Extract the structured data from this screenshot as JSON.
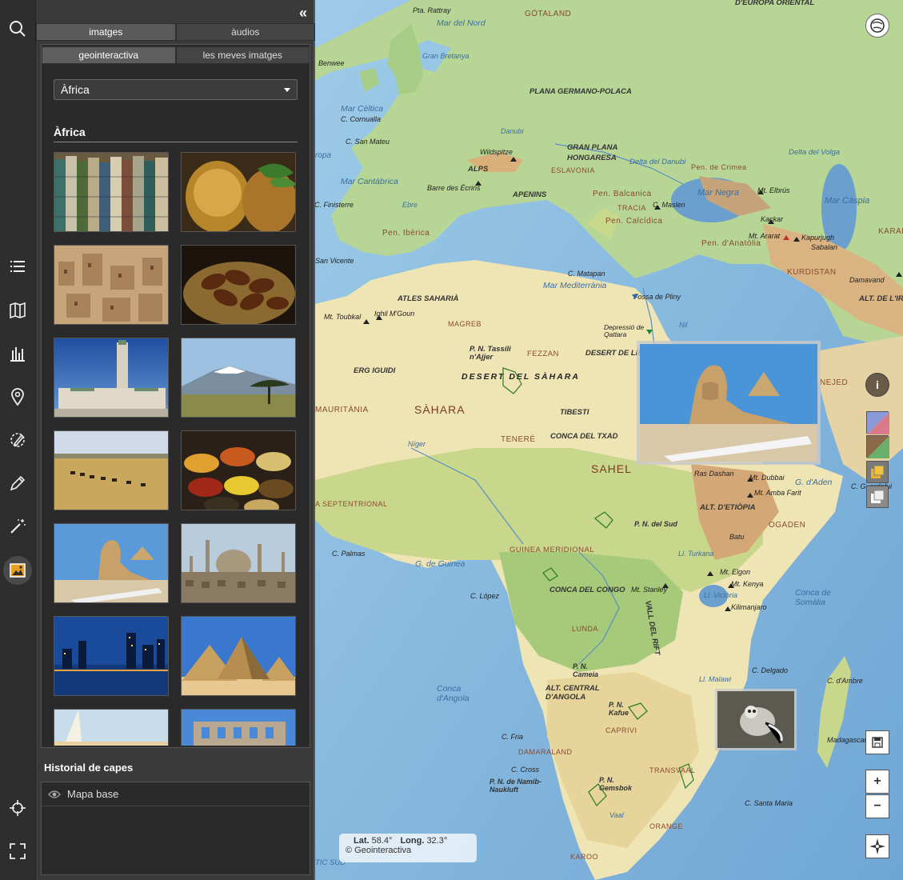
{
  "rail": {
    "items": [
      "search-icon",
      "list-icon",
      "map-book-icon",
      "chart-icon",
      "pin-icon",
      "draw-icon",
      "pencil-icon",
      "wand-icon",
      "image-icon"
    ],
    "bottom": [
      "crosshair-icon",
      "fullscreen-icon"
    ]
  },
  "panel": {
    "collapse": "«",
    "tabs": [
      "imatges",
      "àudios"
    ],
    "subtabs": [
      "geointeractiva",
      "les meves imatges"
    ],
    "select_value": "Àfrica",
    "section_title": "Àfrica",
    "thumbnails": [
      "carpets",
      "mint-tea",
      "kasbah",
      "dates",
      "hassan-mosque",
      "kilimanjaro",
      "savanna",
      "spices",
      "sphinx",
      "cairo-mosque",
      "city-night",
      "pyramids",
      "sail",
      "ruins"
    ]
  },
  "historial": {
    "title": "Historial de capes",
    "layer": "Mapa base"
  },
  "map": {
    "labels": {
      "pta_rattray": "Pta. Rattray",
      "mar_del_nord": "Mar del Nord",
      "gotaland": "GÖTALAND",
      "europa_oriental": "D'EUROPA ORIENTAL",
      "gran_bretanya": "Gran Bretanya",
      "benwee": "Benwee",
      "plana_germano": "PLANA GERMANO-POLACA",
      "mar_celtica": "Mar Cèltica",
      "c_cornualla": "C. Cornualla",
      "c_san_mateu": "C. San Mateu",
      "danubi": "Danubi",
      "gran_plana": "GRAN PLANA",
      "hongaresa": "HONGARESA",
      "wildspitze": "Wildspitze",
      "alps": "ALPS",
      "eslavonia": "ESLAVONIA",
      "delta_danubi": "Delta del Danubi",
      "delta_volga": "Delta del Volga",
      "pen_crimea": "Pen. de Crimea",
      "mar_cantabrica": "Mar Cantàbrica",
      "barre_ecrins": "Barre des Écrins",
      "apenins": "APENINS",
      "pen_balcanica": "Pen. Balcanica",
      "mar_negra": "Mar Negra",
      "mt_elbrus": "Mt. Elbrús",
      "mar_caspia": "Mar Càspia",
      "c_finisterre": "C. Finisterre",
      "ebre": "Ebre",
      "tracia": "TRACIA",
      "c_maslen": "C. Maslen",
      "kackar": "Kaçkar",
      "pen_iberica": "Pen. Ibèrica",
      "pen_calcidica": "Pen. Calcídica",
      "pen_anatolia": "Pen. d'Anatòlia",
      "mt_ararat": "Mt. Ararat",
      "kapurjugh": "Kapurjugh",
      "sabalan": "Sabalan",
      "karak": "KARAK",
      "san_vicente": "San Vicente",
      "c_matapan": "C. Matapan",
      "kurdistan": "KURDISTAN",
      "damavand": "Damavand",
      "mar_mediterrania": "Mar Mediterrània",
      "fossa_pliny": "Fossa de Pliny",
      "alt_iran": "ALT. DE L'IRA",
      "atles_saharia": "ATLES SAHARIÀ",
      "ighil": "Ighil M'Goun",
      "mt_toubkal": "Mt. Toubkal",
      "magreb": "MAGREB",
      "depressio": "Depressió de Qattara",
      "nil": "Nil",
      "tassili": "P. N. Tassili n'Ajjer",
      "fezzan": "FEZZAN",
      "desert_libia": "DESERT DE LÍBIA",
      "erg_iguidi": "ERG IGUIDI",
      "desert_sahara": "DESERT DEL SÀHARA",
      "nejed": "NEJED",
      "mauritania": "MAURITÀNIA",
      "sahara": "SÀHARA",
      "tibesti": "TIBESTI",
      "tenere": "TENERÉ",
      "conca_txad": "CONCA DEL TXAD",
      "niger": "Níger",
      "sahel": "SAHEL",
      "ras_dashan": "Ras Dashan",
      "mt_dubbai": "Mt. Dubbai",
      "g_aden": "G. d'Aden",
      "c_guardafui": "C. Guardafui",
      "mt_amba": "Mt. Amba Farit",
      "septentrional": "A SEPTENTRIONAL",
      "alt_etiopia": "ALT. D'ETIÒPIA",
      "pn_sud": "P. N. del Sud",
      "ogaden": "OGADEN",
      "c_palmas": "C. Palmas",
      "guinea_meridional": "GUINEA MERIDIONAL",
      "l_turkana": "Ll. Turkana",
      "batu": "Batu",
      "g_guinea": "G. de Guinea",
      "mt_elgon": "Mt. Elgon",
      "mt_kenya": "Mt. Kenya",
      "c_lopez": "C. López",
      "conca_congo": "CONCA DEL CONGO",
      "mt_stanley": "Mt. Stanley",
      "l_victoria": "Ll. Victòria",
      "kilimanjaro": "Kilimanjaro",
      "conca_somalia": "Conca de Somàlia",
      "vall_rift": "VALL DEL RIFT",
      "lunda": "LUNDA",
      "conca_angola": "Conca d'Angola",
      "pn_cameia": "P. N. Cameia",
      "alt_angola": "ALT. CENTRAL D'ANGOLA",
      "ll_malawi": "Ll. Malawi",
      "c_delgado": "C. Delgado",
      "c_ambre": "C. d'Ambre",
      "pn_kafue": "P. N. Kafue",
      "caprivi": "CAPRIVI",
      "c_fria": "C. Fria",
      "madagascar": "Madagascar",
      "damaraland": "DAMARALAND",
      "c_cross": "C. Cross",
      "transvaal": "TRANSVAAL",
      "pn_gemsbok": "P. N. Gemsbok",
      "pn_namib": "P. N. de Namib-Naukluft",
      "c_santa_maria": "C. Santa Maria",
      "vaal": "Vaal",
      "orange": "ORANGE",
      "karoo": "KAROO",
      "atlantic_sud": "TIC SUD",
      "ropa": "ropa"
    },
    "coords": {
      "lat_label": "Lat.",
      "lat": "58.4°",
      "long_label": "Long.",
      "long": "32.3°",
      "copyright": "© Geointeractiva"
    },
    "controls": {
      "zoom_in": "+",
      "zoom_out": "−",
      "info": "i"
    }
  }
}
